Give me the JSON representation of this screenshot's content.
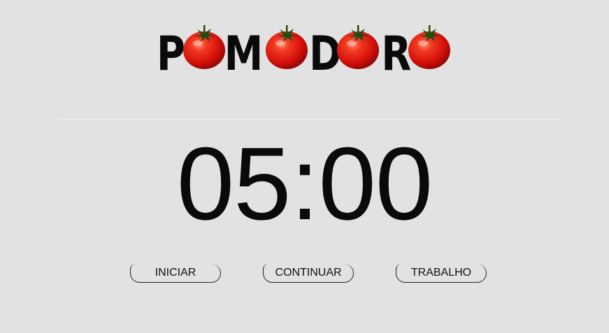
{
  "logo": {
    "text": "POMODORO",
    "letters": [
      "P",
      "M",
      "D",
      "R"
    ],
    "tomato_icons": [
      "tomato-icon",
      "tomato-icon",
      "tomato-icon",
      "tomato-icon"
    ],
    "colors": {
      "letter": "#0a0a0a",
      "tomato": "#e0140f",
      "stem": "#1f4d12"
    }
  },
  "timer": {
    "display": "05:00"
  },
  "controls": {
    "start_label": "INICIAR",
    "continue_label": "CONTINUAR",
    "work_label": "TRABALHO"
  },
  "theme": {
    "background": "#e3e2e3",
    "divider": "#ececec",
    "text": "#0a0a0a"
  }
}
